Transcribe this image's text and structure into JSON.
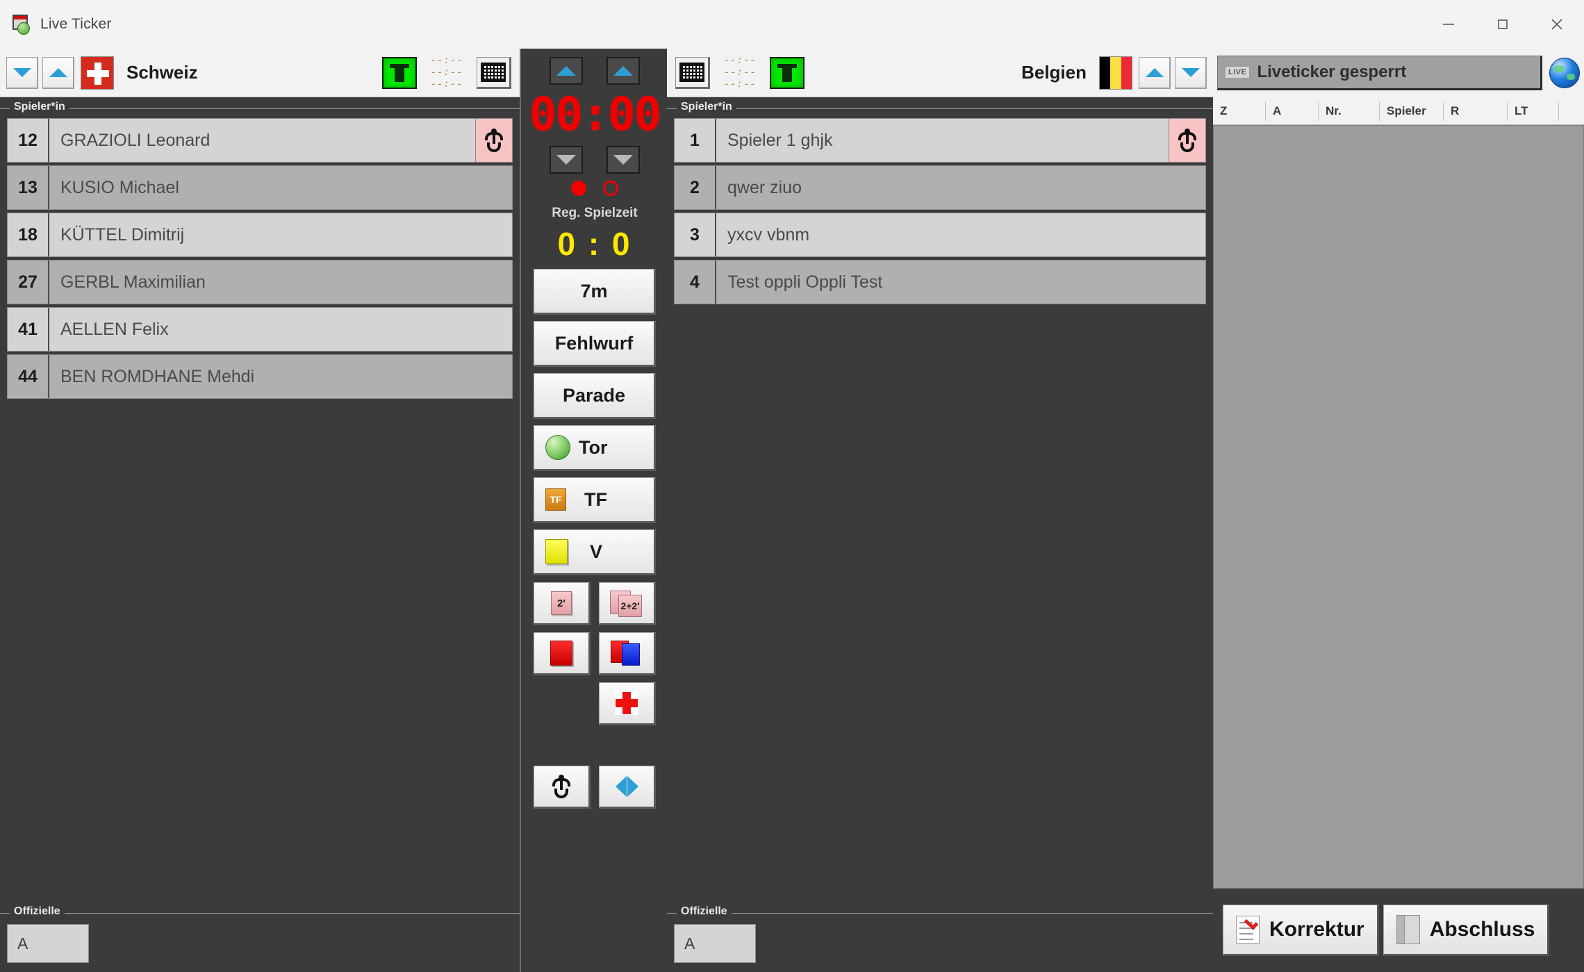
{
  "window": {
    "title": "Live Ticker",
    "icon": "calendar-ball-icon",
    "minimize_label": "–",
    "maximize_label": "□",
    "close_label": "×"
  },
  "home_team": {
    "name": "Schweiz",
    "flag": "flag-switzerland",
    "flag_colors": [
      "#d52b1e",
      "#ffffff"
    ],
    "down_button": "chevron-down",
    "up_button": "chevron-up",
    "green_button": "green-timeout-button",
    "time_display": [
      "--:--",
      "--:--",
      "--:--"
    ],
    "goal_button": "goal-net-icon",
    "players_group_title": "Spieler*in",
    "players": [
      {
        "number": "12",
        "name": "GRAZIOLI Leonard",
        "goalkeeper": true
      },
      {
        "number": "13",
        "name": "KUSIO Michael",
        "goalkeeper": false
      },
      {
        "number": "18",
        "name": "KÜTTEL Dimitrij",
        "goalkeeper": false
      },
      {
        "number": "27",
        "name": "GERBL Maximilian",
        "goalkeeper": false
      },
      {
        "number": "41",
        "name": "AELLEN Felix",
        "goalkeeper": false
      },
      {
        "number": "44",
        "name": "BEN ROMDHANE Mehdi",
        "goalkeeper": false
      }
    ],
    "officials_group_title": "Offizielle",
    "officials": [
      {
        "letter": "A",
        "name": ""
      }
    ]
  },
  "away_team": {
    "name": "Belgien",
    "flag": "flag-belgium",
    "flag_colors": [
      "#000000",
      "#fae042",
      "#ed2939"
    ],
    "up_button": "chevron-up",
    "down_button": "chevron-down",
    "green_button": "green-timeout-button",
    "time_display": [
      "--:--",
      "--:--",
      "--:--"
    ],
    "goal_button": "goal-net-icon",
    "players_group_title": "Spieler*in",
    "players": [
      {
        "number": "1",
        "name": "Spieler 1 ghjk",
        "goalkeeper": true
      },
      {
        "number": "2",
        "name": "qwer ziuo",
        "goalkeeper": false
      },
      {
        "number": "3",
        "name": "yxcv vbnm",
        "goalkeeper": false
      },
      {
        "number": "4",
        "name": "Test oppli Oppli Test",
        "goalkeeper": false
      }
    ],
    "officials_group_title": "Offizielle",
    "officials": [
      {
        "letter": "A",
        "name": ""
      }
    ]
  },
  "center": {
    "clock": "00:00",
    "clock_color": "#f10000",
    "arrow_up_left": "chevron-up",
    "arrow_up_right": "chevron-up",
    "arrow_down_left": "chevron-down",
    "arrow_down_right": "chevron-down",
    "indicator_filled": "red-filled-circle",
    "indicator_hollow": "red-hollow-circle",
    "period_label": "Reg. Spielzeit",
    "score": "0 : 0",
    "score_color": "#ffe800",
    "buttons": [
      {
        "label": "7m",
        "icon": ""
      },
      {
        "label": "Fehlwurf",
        "icon": ""
      },
      {
        "label": "Parade",
        "icon": ""
      },
      {
        "label": "Tor",
        "icon": "green-ball-icon"
      },
      {
        "label": "TF",
        "icon": "tf-orange-icon"
      },
      {
        "label": "V",
        "icon": "yellow-card-icon"
      }
    ],
    "small_buttons": [
      {
        "name": "two-minute-suspension",
        "label": "2'"
      },
      {
        "name": "two-plus-two-suspension",
        "label": "2+2'"
      },
      {
        "name": "red-card",
        "label": ""
      },
      {
        "name": "red-blue-card",
        "label": ""
      },
      {
        "name": "injury-cross",
        "label": ""
      },
      {
        "name": "player-figure",
        "label": ""
      },
      {
        "name": "substitution",
        "label": ""
      }
    ]
  },
  "ticker": {
    "status_badge": "LIVE",
    "status_text": "Liveticker gesperrt",
    "globe_icon": "globe-icon",
    "columns": [
      "Z",
      "A",
      "Nr.",
      "Spieler",
      "R",
      "LT",
      ""
    ],
    "rows": [],
    "footer_buttons": [
      {
        "label": "Korrektur",
        "icon": "checklist-icon"
      },
      {
        "label": "Abschluss",
        "icon": "book-icon"
      }
    ]
  }
}
